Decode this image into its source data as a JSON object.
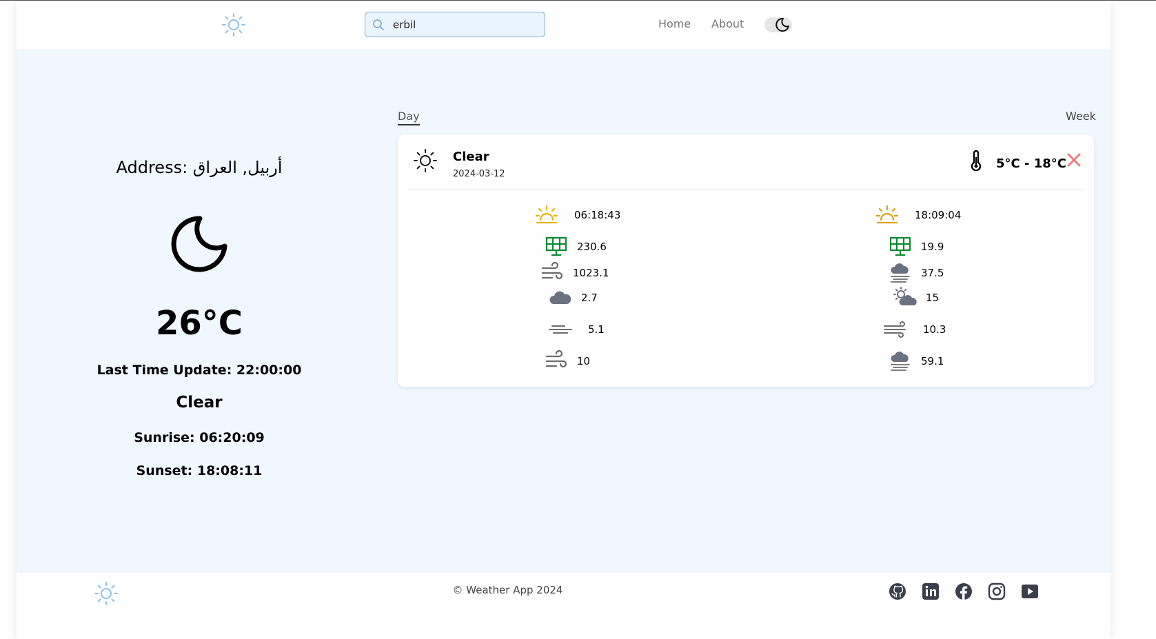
{
  "header": {
    "search_value": "erbil",
    "nav_home": "Home",
    "nav_about": "About"
  },
  "current": {
    "address": "Address: أربيل, العراق",
    "temperature": "26°C",
    "last_update": "Last Time Update: 22:00:00",
    "condition": "Clear",
    "sunrise": "Sunrise: 06:20:09",
    "sunset": "Sunset: 18:08:11"
  },
  "tabs": {
    "day": "Day",
    "week": "Week"
  },
  "forecast_card": {
    "condition": "Clear",
    "date": "2024-03-12",
    "temp_range": "5°C - 18°C",
    "stats_left": [
      "06:18:43",
      "230.6",
      "1023.1",
      "2.7",
      "5.1",
      "10"
    ],
    "stats_right": [
      "18:09:04",
      "19.9",
      "37.5",
      "15",
      "10.3",
      "59.1"
    ]
  },
  "footer": {
    "copyright": "© Weather App 2024"
  },
  "colors": {
    "brand_sun": "#8cc1e4",
    "background": "#f0f7fe",
    "sun_yellow": "#e8b20c",
    "solar_green": "#0b8a32",
    "close_red": "#f07d7d"
  }
}
